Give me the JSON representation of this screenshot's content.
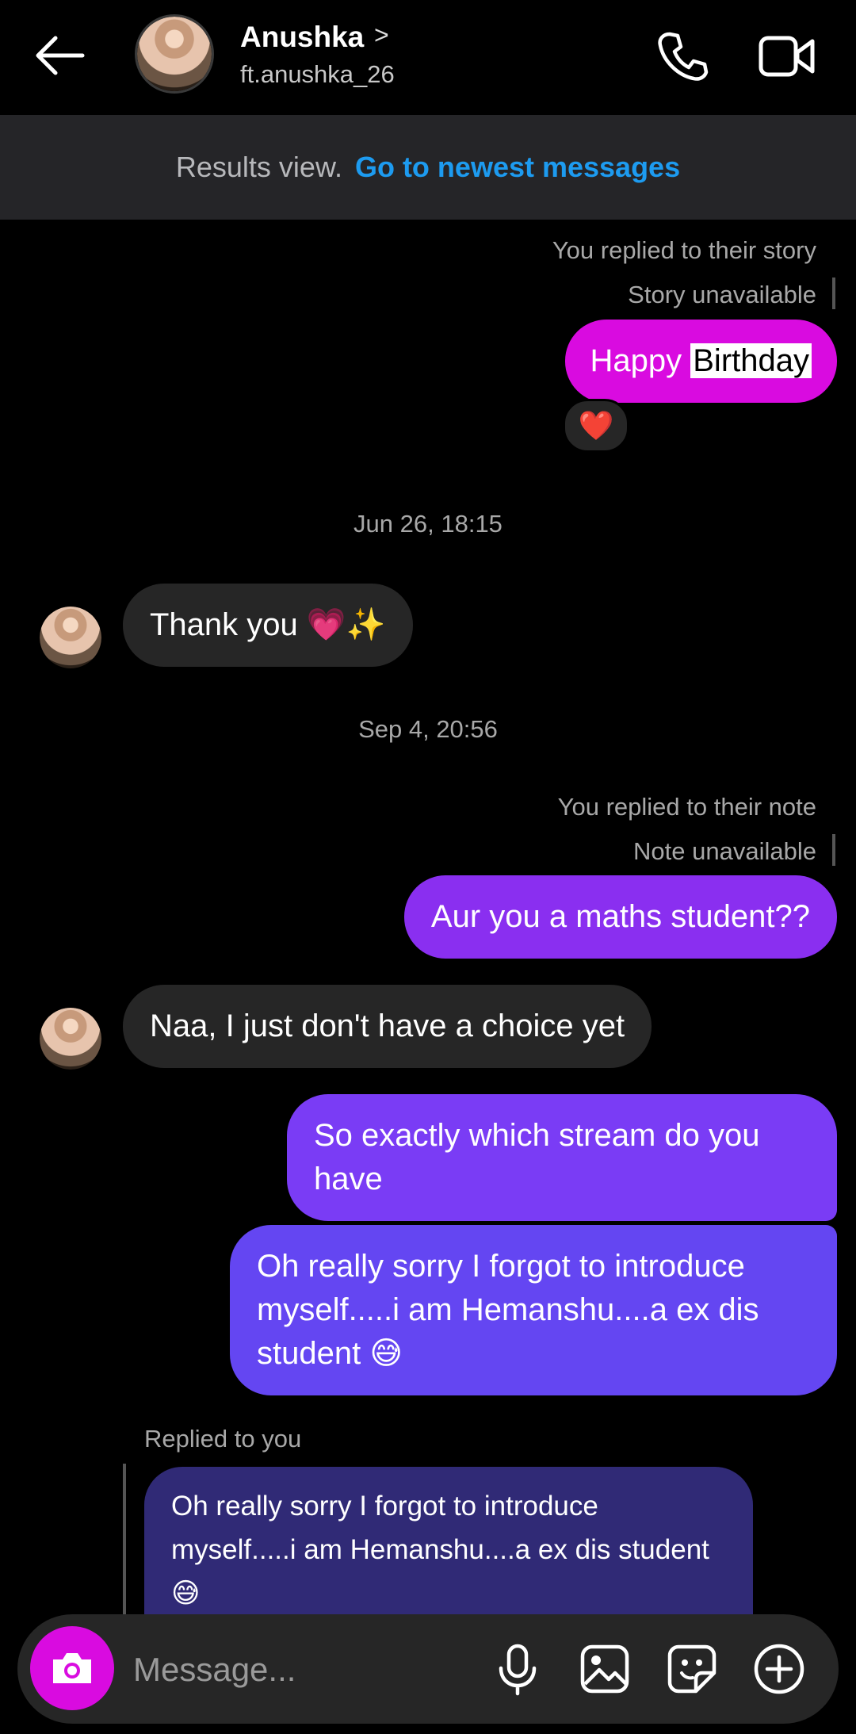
{
  "header": {
    "name": "Anushka",
    "chevron": ">",
    "handle": "ft.anushka_26",
    "icons": [
      "back-arrow-icon",
      "phone-icon",
      "video-camera-icon"
    ]
  },
  "banner": {
    "text": "Results view.",
    "link": "Go to newest messages"
  },
  "messages": {
    "story_reply_label": "You replied to their story",
    "story_unavailable": "Story unavailable",
    "birthday_prefix": "Happy",
    "birthday_highlight": "Birthday",
    "reaction": "❤️",
    "ts1": "Jun 26, 18:15",
    "thank_you": "Thank you 💗✨",
    "ts2": "Sep 4, 20:56",
    "note_reply_label": "You replied to their note",
    "note_unavailable": "Note unavailable",
    "maths": "Aur you a maths student??",
    "naa": "Naa, I just don't have a choice yet",
    "stream": "So exactly which stream do you have",
    "sorry": "Oh really sorry I forgot to introduce myself.....i am Hemanshu....a ex dis student 😅",
    "replied_label": "Replied to you",
    "quoted": "Oh really sorry I forgot to introduce myself.....i am Hemanshu....a ex dis student 😅"
  },
  "composer": {
    "placeholder": "Message...",
    "icons": [
      "camera-icon",
      "microphone-icon",
      "gallery-icon",
      "sticker-icon",
      "plus-icon"
    ]
  },
  "colors": {
    "story_bubble": "#d90be0",
    "note_bubble": "#8a2ff0",
    "purple_bubble": "#7a3cf5",
    "indigo_bubble": "#6446f2",
    "quote_bg": "#302a76",
    "link": "#1d9bf0"
  }
}
